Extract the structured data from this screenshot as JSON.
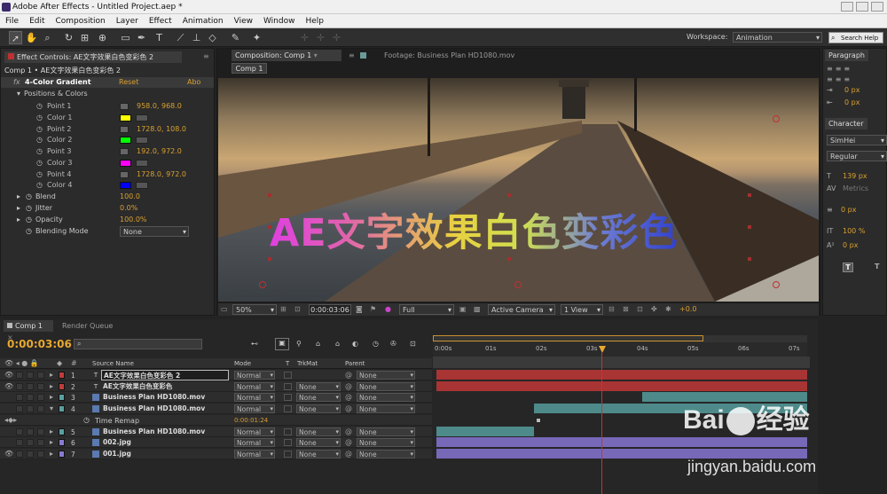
{
  "window": {
    "title": "Adobe After Effects - Untitled Project.aep *"
  },
  "menu": [
    "File",
    "Edit",
    "Composition",
    "Layer",
    "Effect",
    "Animation",
    "View",
    "Window",
    "Help"
  ],
  "toolbar": {
    "workspace_label": "Workspace:",
    "workspace_value": "Animation",
    "search_placeholder": "Search Help"
  },
  "effect_controls": {
    "tab_label": "Effect Controls: AE文字效果白色变彩色 2",
    "breadcrumb": "Comp 1 • AE文字效果白色变彩色 2",
    "effect_name": "4-Color Gradient",
    "reset": "Reset",
    "about": "Abo",
    "group": "Positions & Colors",
    "rows": [
      {
        "label": "Point 1",
        "value": "958.0, 968.0"
      },
      {
        "label": "Color 1",
        "color": "#ffff00"
      },
      {
        "label": "Point 2",
        "value": "1728.0, 108.0"
      },
      {
        "label": "Color 2",
        "color": "#00ff00"
      },
      {
        "label": "Point 3",
        "value": "192.0, 972.0"
      },
      {
        "label": "Color 3",
        "color": "#ff00ff"
      },
      {
        "label": "Point 4",
        "value": "1728.0, 972.0"
      },
      {
        "label": "Color 4",
        "color": "#0000ff"
      }
    ],
    "blend": {
      "label": "Blend",
      "value": "100.0"
    },
    "jitter": {
      "label": "Jitter",
      "value": "0.0%"
    },
    "opacity": {
      "label": "Opacity",
      "value": "100.0%"
    },
    "blending_mode": {
      "label": "Blending Mode",
      "value": "None"
    }
  },
  "viewer": {
    "tab_comp": "Composition: Comp 1",
    "tab_footage": "Footage: Business Plan HD1080.mov",
    "comp_chip": "Comp 1",
    "overlay_text": "AE文字效果白色变彩色",
    "zoom": "50%",
    "timecode": "0:00:03:06",
    "resolution": "Full",
    "camera": "Active Camera",
    "view": "1 View",
    "exposure": "+0.0"
  },
  "right_panel": {
    "paragraph": "Paragraph",
    "px1": "0 px",
    "px2": "0 px",
    "character": "Character",
    "font": "SimHei",
    "style": "Regular",
    "size": "139 px",
    "tracking": "Metrics",
    "stroke": "0 px",
    "scale": "100 %",
    "baseline": "0 px"
  },
  "timeline": {
    "tab_comp": "Comp 1",
    "tab_render": "Render Queue",
    "timecode": "0:00:03:06",
    "columns": {
      "source": "Source Name",
      "mode": "Mode",
      "t": "T",
      "trkmat": "TrkMat",
      "parent": "Parent"
    },
    "ticks": [
      "0:00s",
      "01s",
      "02s",
      "03s",
      "04s",
      "05s",
      "06s",
      "07s"
    ],
    "layers": [
      {
        "num": "1",
        "name": "AE文字效果白色变彩色 2",
        "mode": "Normal",
        "trkmat": "",
        "parent": "None",
        "color": "#c03c3c"
      },
      {
        "num": "2",
        "name": "AE文字效果白色变彩色",
        "mode": "Normal",
        "trkmat": "None",
        "parent": "None",
        "color": "#c03c3c"
      },
      {
        "num": "3",
        "name": "Business Plan HD1080.mov",
        "mode": "Normal",
        "trkmat": "None",
        "parent": "None",
        "color": "#5aa0a0"
      },
      {
        "num": "4",
        "name": "Business Plan HD1080.mov",
        "mode": "Normal",
        "trkmat": "None",
        "parent": "None",
        "color": "#5aa0a0"
      },
      {
        "num": "",
        "name": "Time Remap",
        "value": "0:00:01:24",
        "sub": true
      },
      {
        "num": "5",
        "name": "Business Plan HD1080.mov",
        "mode": "Normal",
        "trkmat": "None",
        "parent": "None",
        "color": "#5aa0a0"
      },
      {
        "num": "6",
        "name": "002.jpg",
        "mode": "Normal",
        "trkmat": "None",
        "parent": "None",
        "color": "#8a7ad0"
      },
      {
        "num": "7",
        "name": "001.jpg",
        "mode": "Normal",
        "trkmat": "None",
        "parent": "None",
        "color": "#8a7ad0"
      }
    ]
  },
  "watermark": {
    "brand": "Bai",
    "brand2": "经验",
    "url": "jingyan.baidu.com"
  }
}
